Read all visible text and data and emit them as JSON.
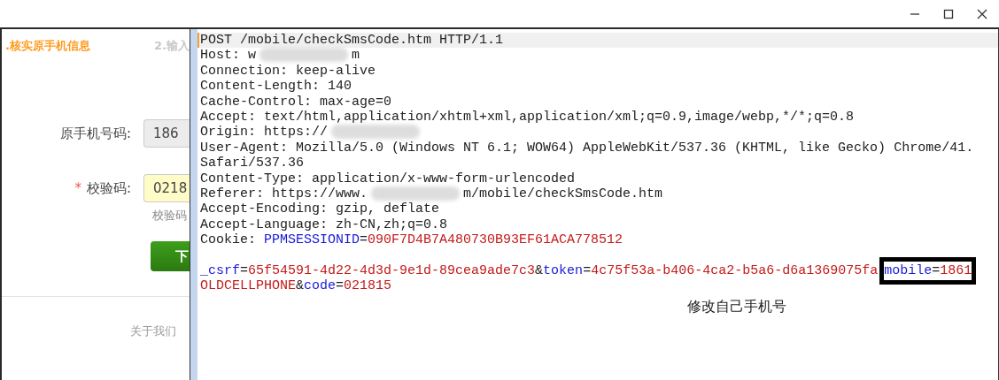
{
  "window": {
    "controls": [
      {
        "kind": "minimize"
      },
      {
        "kind": "maximize"
      },
      {
        "kind": "close"
      }
    ]
  },
  "web_page": {
    "steps": [
      {
        "label": ".核实原手机信息",
        "selected": true
      },
      {
        "label": "2.输入",
        "selected": false
      }
    ],
    "fields": [
      {
        "label": "原手机号码:",
        "value": "186",
        "required": false,
        "editable": false
      },
      {
        "label": "校验码:",
        "value": "0218",
        "required": true,
        "editable": true,
        "hint": "校验码"
      }
    ],
    "required_mark": "*",
    "button": "下",
    "footer_link": "关于我们"
  },
  "request": {
    "lines": [
      {
        "current": true,
        "segments": [
          {
            "kind": "plain",
            "text": "POST /mobile/checkSmsCode.htm HTTP/1.1"
          }
        ]
      },
      {
        "current": false,
        "segments": [
          {
            "kind": "plain",
            "text": "Host: w"
          },
          {
            "kind": "redacted"
          },
          {
            "kind": "plain",
            "text": "m"
          }
        ]
      },
      {
        "current": false,
        "segments": [
          {
            "kind": "plain",
            "text": "Connection: keep-alive"
          }
        ]
      },
      {
        "current": false,
        "segments": [
          {
            "kind": "plain",
            "text": "Content-Length: 140"
          }
        ]
      },
      {
        "current": false,
        "segments": [
          {
            "kind": "plain",
            "text": "Cache-Control: max-age=0"
          }
        ]
      },
      {
        "current": false,
        "segments": [
          {
            "kind": "plain",
            "text": "Accept: text/html,application/xhtml+xml,application/xml;q=0.9,image/webp,*/*;q=0.8"
          }
        ]
      },
      {
        "current": false,
        "segments": [
          {
            "kind": "plain",
            "text": "Origin: https://"
          },
          {
            "kind": "redacted"
          }
        ]
      },
      {
        "current": false,
        "segments": [
          {
            "kind": "plain",
            "text": "User-Agent: Mozilla/5.0 (Windows NT 6.1; WOW64) AppleWebKit/537.36 (KHTML, like Gecko) Chrome/41."
          }
        ]
      },
      {
        "current": false,
        "segments": [
          {
            "kind": "plain",
            "text": "Safari/537.36"
          }
        ]
      },
      {
        "current": false,
        "segments": [
          {
            "kind": "plain",
            "text": "Content-Type: application/x-www-form-urlencoded"
          }
        ]
      },
      {
        "current": false,
        "segments": [
          {
            "kind": "plain",
            "text": "Referer: https://www."
          },
          {
            "kind": "redacted"
          },
          {
            "kind": "plain",
            "text": "m/mobile/checkSmsCode.htm"
          }
        ]
      },
      {
        "current": false,
        "segments": [
          {
            "kind": "plain",
            "text": "Accept-Encoding: gzip, deflate"
          }
        ]
      },
      {
        "current": false,
        "segments": [
          {
            "kind": "plain",
            "text": "Accept-Language: zh-CN,zh;q=0.8"
          }
        ]
      },
      {
        "current": false,
        "segments": [
          {
            "kind": "plain",
            "text": "Cookie: "
          },
          {
            "kind": "param",
            "text": "PPMSESSIONID"
          },
          {
            "kind": "plain",
            "text": "="
          },
          {
            "kind": "value",
            "text": "090F7D4B7A480730B93EF61ACA778512"
          }
        ]
      },
      {
        "current": false
      },
      {
        "current": false,
        "segments": [
          {
            "kind": "param",
            "text": "_csrf"
          },
          {
            "kind": "plain",
            "text": "="
          },
          {
            "kind": "value",
            "text": "65f54591-4d22-4d3d-9e1d-89cea9ade7c3"
          },
          {
            "kind": "plain",
            "text": "&"
          },
          {
            "kind": "param",
            "text": "token"
          },
          {
            "kind": "plain",
            "text": "="
          },
          {
            "kind": "value",
            "text": "4c75f53a-b406-4ca2-b5a6-d6a1369075fa"
          },
          {
            "kind": "param",
            "text": "mobile",
            "highlighted": true
          },
          {
            "kind": "plain",
            "text": "=",
            "highlighted": true
          },
          {
            "kind": "value",
            "text": "1861",
            "highlighted": true
          }
        ]
      },
      {
        "current": false,
        "segments": [
          {
            "kind": "value",
            "text": "OLDCELLPHONE"
          },
          {
            "kind": "plain",
            "text": "&"
          },
          {
            "kind": "param",
            "text": "code"
          },
          {
            "kind": "plain",
            "text": "="
          },
          {
            "kind": "value",
            "text": "021815"
          }
        ]
      }
    ],
    "annotation": "修改自己手机号"
  }
}
